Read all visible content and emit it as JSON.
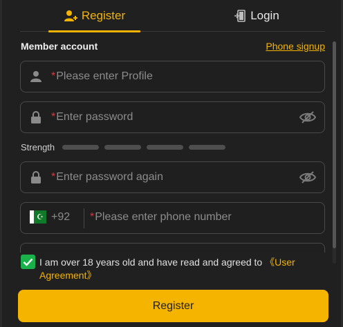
{
  "tabs": {
    "register_label": "Register",
    "login_label": "Login"
  },
  "form": {
    "section_label": "Member account",
    "phone_signup_link": "Phone signup",
    "required_mark": "*",
    "profile_placeholder": "Please enter Profile",
    "password_placeholder": "Enter password",
    "strength_label": "Strength",
    "strength_bars": 4,
    "strength_level": 0,
    "password_again_placeholder": "Enter password again",
    "phone_code": "+92",
    "phone_placeholder": "Please enter phone number",
    "country_flag": "pakistan-flag"
  },
  "agreement": {
    "checked": true,
    "text": "I am over 18 years old and have read and agreed to ",
    "link": "《User Agreement》"
  },
  "submit_label": "Register",
  "colors": {
    "accent": "#f5b400",
    "required": "#e0353b",
    "checkbox": "#19b24a",
    "background": "#202020"
  }
}
